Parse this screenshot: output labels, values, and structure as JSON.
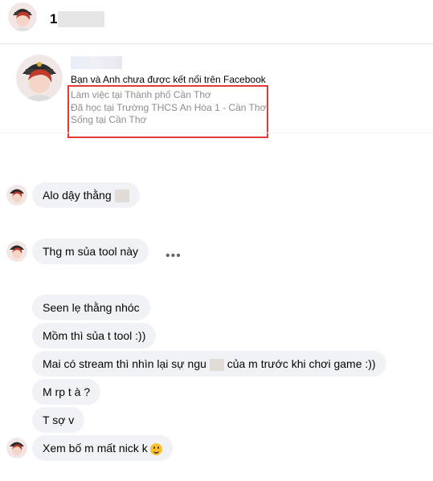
{
  "header": {
    "name": "1"
  },
  "profile": {
    "connection_text": "Bạn và Anh chưa được kết nối trên Facebook",
    "details": [
      "Làm việc tại Thành phố Cần Thơ",
      "Đã học tại Trường THCS An Hòa 1 - Cần Thơ",
      "Sống tại Cần Thơ"
    ]
  },
  "messages": [
    {
      "text": "Alo dậy thằng"
    },
    {
      "text": "Thg m sủa tool này"
    },
    {
      "text": "Seen lẹ thằng nhóc"
    },
    {
      "text": "Mồm thì sủa t tool :))"
    },
    {
      "text_a": "Mai có stream thì nhìn lại sự ngu",
      "text_b": "của m trước khi chơi game :))"
    },
    {
      "text": "M rp t à ?"
    },
    {
      "text": "T sợ v"
    },
    {
      "text": "Xem bố m mất nick k"
    }
  ],
  "colors": {
    "highlight_box": "#e53935",
    "bubble": "#f0f2f5"
  },
  "icons": {
    "more": "more-options-icon",
    "emoji": "smile-emoji-icon"
  }
}
